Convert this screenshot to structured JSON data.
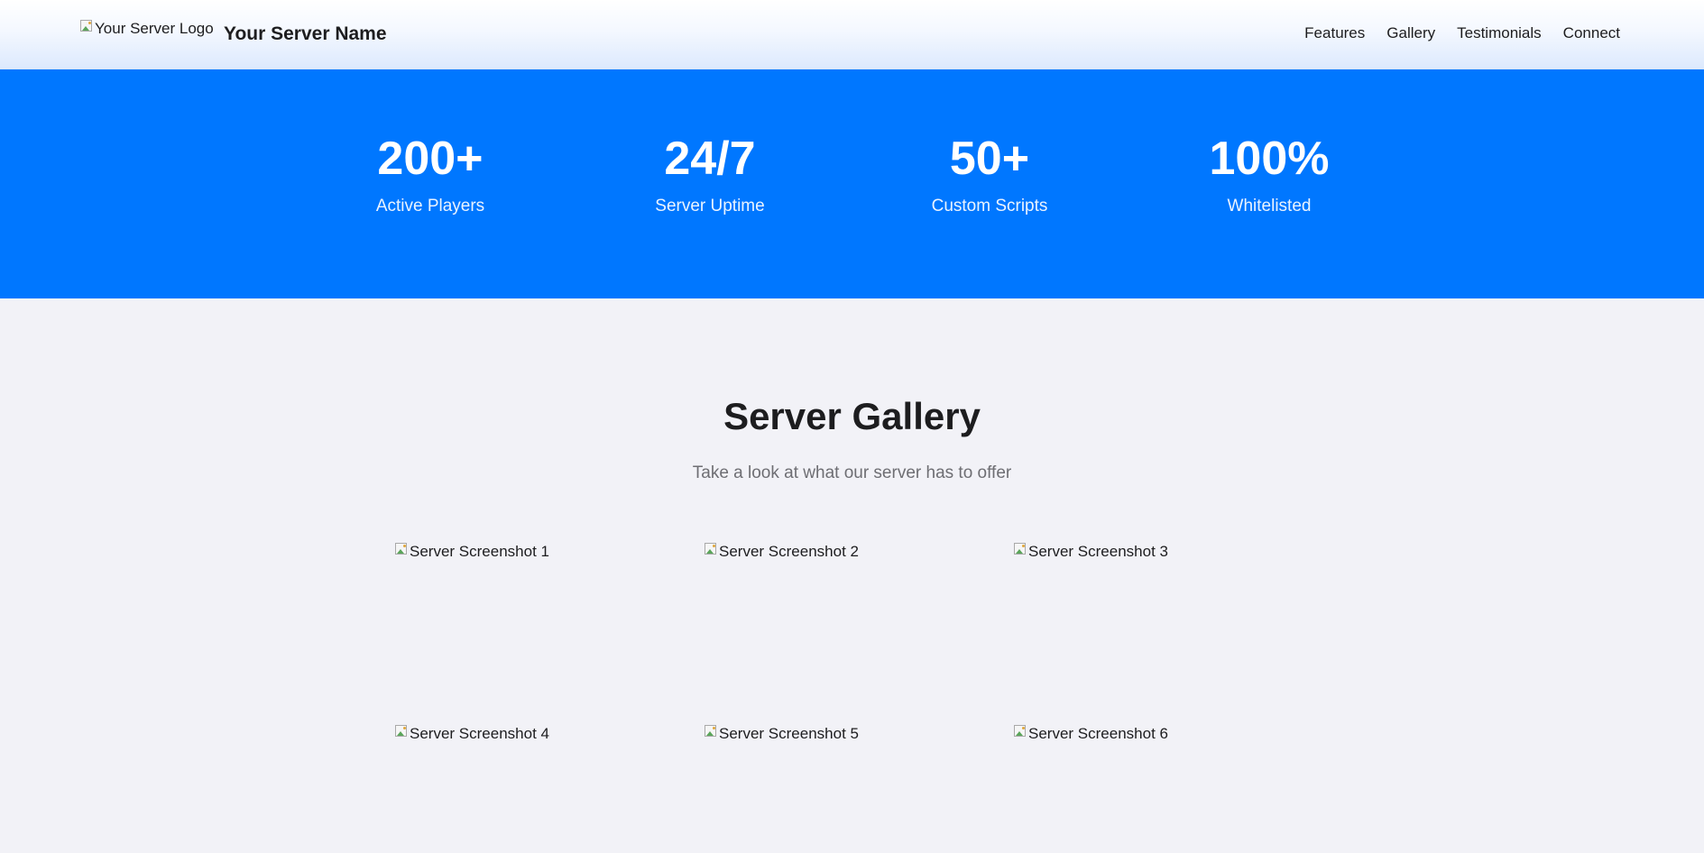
{
  "header": {
    "logo_alt": "Your Server Logo",
    "server_name": "Your Server Name",
    "nav": [
      "Features",
      "Gallery",
      "Testimonials",
      "Connect"
    ]
  },
  "stats": [
    {
      "value": "200+",
      "label": "Active Players"
    },
    {
      "value": "24/7",
      "label": "Server Uptime"
    },
    {
      "value": "50+",
      "label": "Custom Scripts"
    },
    {
      "value": "100%",
      "label": "Whitelisted"
    }
  ],
  "gallery": {
    "title": "Server Gallery",
    "subtitle": "Take a look at what our server has to offer",
    "images": [
      "Server Screenshot 1",
      "Server Screenshot 2",
      "Server Screenshot 3",
      "Server Screenshot 4",
      "Server Screenshot 5",
      "Server Screenshot 6"
    ]
  },
  "colors": {
    "accent": "#0077ff",
    "background": "#f2f2f7",
    "text": "#1d1d1f",
    "muted": "#6e6e73"
  }
}
